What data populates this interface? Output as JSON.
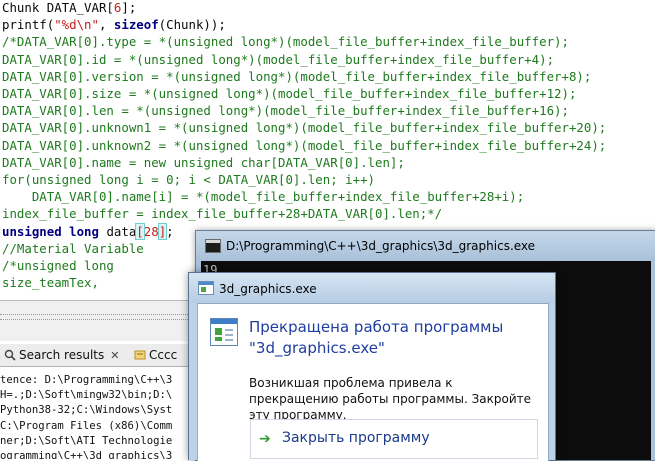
{
  "editor": {
    "lines": [
      [
        {
          "t": "Chunk DATA_VAR[",
          "c": "black"
        },
        {
          "t": "6",
          "c": "red"
        },
        {
          "t": "];",
          "c": "black"
        }
      ],
      [
        {
          "t": "printf(",
          "c": "black"
        },
        {
          "t": "\"%d\\n\"",
          "c": "red"
        },
        {
          "t": ", ",
          "c": "black"
        },
        {
          "t": "sizeof",
          "c": "blue"
        },
        {
          "t": "(Chunk));",
          "c": "black"
        }
      ],
      [
        {
          "t": "/*DATA_VAR[0].type = *(unsigned long*)(model_file_buffer+index_file_buffer);",
          "c": "green"
        }
      ],
      [
        {
          "t": "DATA_VAR[0].id = *(unsigned long*)(model_file_buffer+index_file_buffer+4);",
          "c": "green"
        }
      ],
      [
        {
          "t": "DATA_VAR[0].version = *(unsigned long*)(model_file_buffer+index_file_buffer+8);",
          "c": "green"
        }
      ],
      [
        {
          "t": "DATA_VAR[0].size = *(unsigned long*)(model_file_buffer+index_file_buffer+12);",
          "c": "green"
        }
      ],
      [
        {
          "t": "DATA_VAR[0].len = *(unsigned long*)(model_file_buffer+index_file_buffer+16);",
          "c": "green"
        }
      ],
      [
        {
          "t": "DATA_VAR[0].unknown1 = *(unsigned long*)(model_file_buffer+index_file_buffer+20);",
          "c": "green"
        }
      ],
      [
        {
          "t": "DATA_VAR[0].unknown2 = *(unsigned long*)(model_file_buffer+index_file_buffer+24);",
          "c": "green"
        }
      ],
      [
        {
          "t": "DATA_VAR[0].name = new unsigned char[DATA_VAR[0].len];",
          "c": "green"
        }
      ],
      [
        {
          "t": "for(unsigned long i = 0; i < DATA_VAR[0].len; i++)",
          "c": "green"
        }
      ],
      [
        {
          "t": "    DATA_VAR[0].name[i] = *(model_file_buffer+index_file_buffer+28+i);",
          "c": "green"
        }
      ],
      [
        {
          "t": "index_file_buffer = index_file_buffer+28+DATA_VAR[0].len;*/",
          "c": "green"
        }
      ],
      [
        {
          "t": "unsigned long",
          "c": "blue"
        },
        {
          "t": " data",
          "c": "black"
        },
        {
          "t": "[",
          "c": "hl"
        },
        {
          "t": "28",
          "c": "red"
        },
        {
          "t": "]",
          "c": "hl"
        },
        {
          "t": ";",
          "c": "black"
        }
      ],
      [
        {
          "t": "//Material Variable",
          "c": "green"
        }
      ],
      [
        {
          "t": "/*unsigned long",
          "c": "green"
        }
      ],
      [
        {
          "t": "size_teamTex,",
          "c": "green"
        }
      ]
    ]
  },
  "bottom_panel": {
    "tabs": [
      {
        "label": "Search results",
        "icon": "search-results-icon"
      },
      {
        "label": "Cccc",
        "icon": "cccc-icon"
      }
    ],
    "log_lines": [
      "tence: D:\\Programming\\C++\\3",
      "H=.;D:\\Soft\\mingw32\\bin;D:\\",
      "Python38-32;C:\\Windows\\Syst",
      "C:\\Program Files (x86)\\Comm",
      "ner;D:\\Soft\\ATI Technologie",
      "ogramming\\C++\\3d_graphics\\3"
    ]
  },
  "console": {
    "title": "D:\\Programming\\C++\\3d_graphics\\3d_graphics.exe",
    "output": "19"
  },
  "dialog": {
    "title": "3d_graphics.exe",
    "heading": "Прекращена работа программы \"3d_graphics.exe\"",
    "description": "Возникшая проблема привела к прекращению работы программы. Закройте эту программу.",
    "close_button": "Закрыть программу"
  },
  "colors": {
    "code_green": "#1e7a1e",
    "code_red": "#c81e1e",
    "code_keyword": "#00007f",
    "dialog_heading": "#1e3da0",
    "console_bg": "#0c0c0c"
  }
}
